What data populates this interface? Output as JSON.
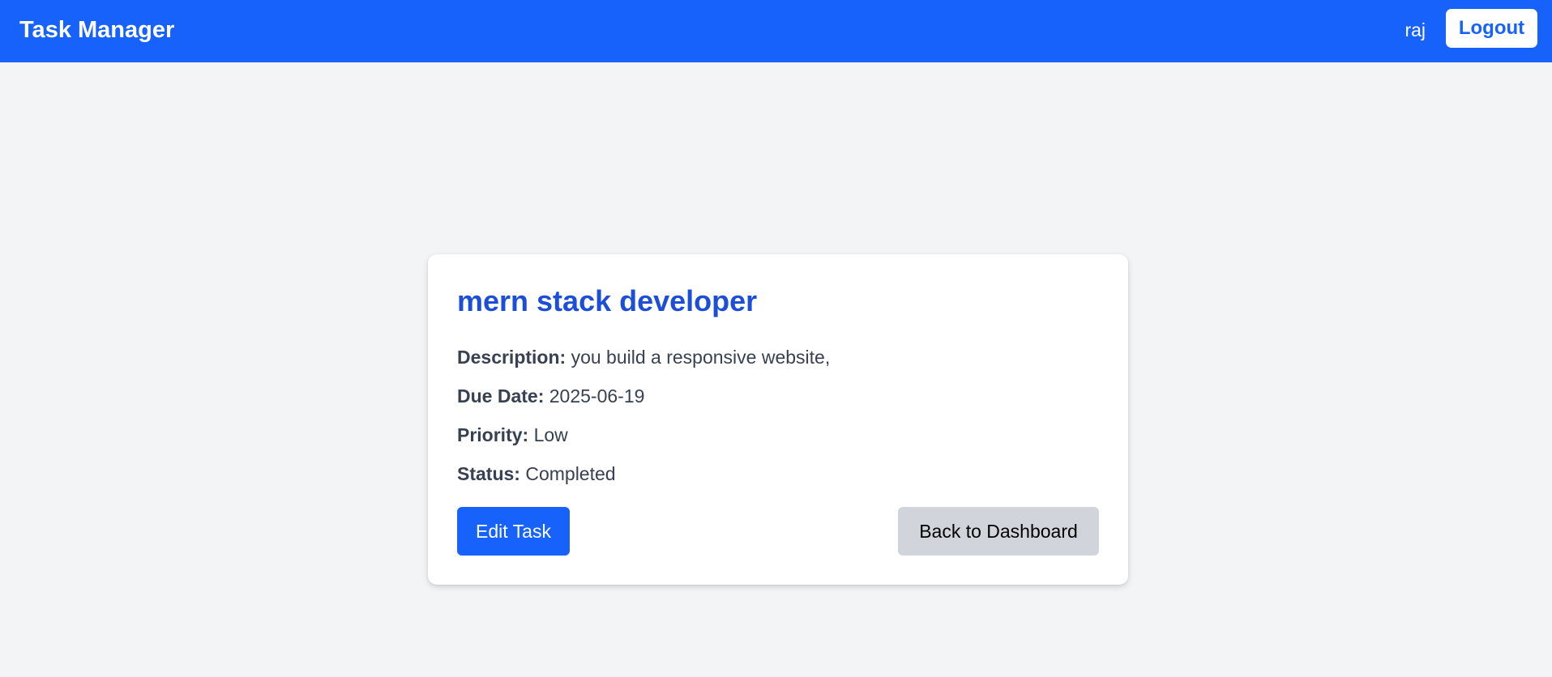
{
  "navbar": {
    "brand": "Task Manager",
    "username": "raj",
    "logout_label": "Logout"
  },
  "task": {
    "title": "mern stack developer",
    "description_label": "Description:",
    "description": "you build a responsive website,",
    "due_date_label": "Due Date:",
    "due_date": "2025-06-19",
    "priority_label": "Priority:",
    "priority": "Low",
    "status_label": "Status:",
    "status": "Completed"
  },
  "actions": {
    "edit_label": "Edit Task",
    "back_label": "Back to Dashboard"
  },
  "colors": {
    "accent": "#1662fb",
    "title": "#1d4ed8",
    "page_bg": "#f3f4f6",
    "secondary_button": "#d1d5db"
  }
}
